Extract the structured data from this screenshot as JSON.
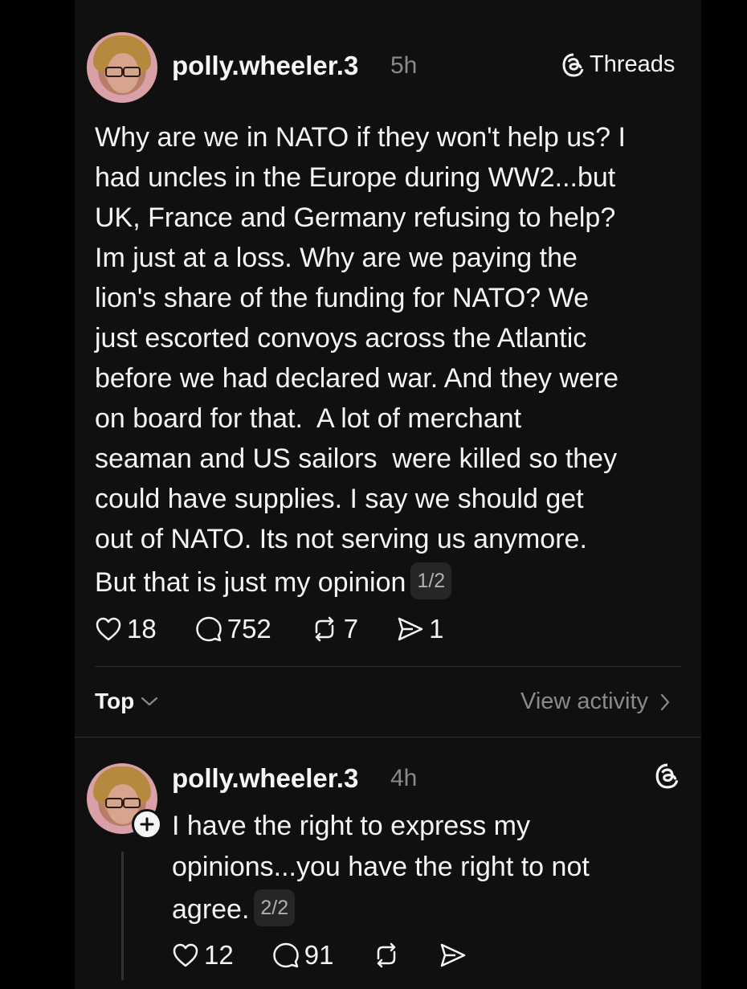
{
  "app": {
    "name": "Threads"
  },
  "post": {
    "username": "polly.wheeler.3",
    "time": "5h",
    "text_lines": [
      "Why are we in NATO if they won't help us? I",
      "had uncles in the Europe during WW2...but",
      "UK, France and Germany refusing to help?",
      "Im just at a loss. Why are we paying the",
      "lion's share of the funding for NATO? We",
      "just escorted convoys across the Atlantic",
      "before we had declared war. And they were",
      "on board for that.  A lot of merchant",
      "seaman and US sailors  were killed so they",
      "could have supplies. I say we should get",
      "out of NATO. Its not serving us anymore.",
      "But that is just my opinion"
    ],
    "pager": "1/2",
    "likes": "18",
    "replies": "752",
    "reposts": "7",
    "shares": "1"
  },
  "replies_bar": {
    "sort_label": "Top",
    "activity_label": "View activity"
  },
  "reply": {
    "username": "polly.wheeler.3",
    "time": "4h",
    "text_lines": [
      "I have the right to express my",
      "opinions...you have the right to not",
      "agree."
    ],
    "pager": "2/2",
    "likes": "12",
    "replies": "91"
  },
  "icons": {
    "threads_logo": "threads-logo-icon",
    "like": "heart-icon",
    "reply": "speech-bubble-icon",
    "repost": "repost-icon",
    "share": "send-icon",
    "follow": "plus-icon"
  },
  "colors": {
    "background": "#101010",
    "text": "#f3f5f7",
    "muted": "#8a8a8a"
  }
}
